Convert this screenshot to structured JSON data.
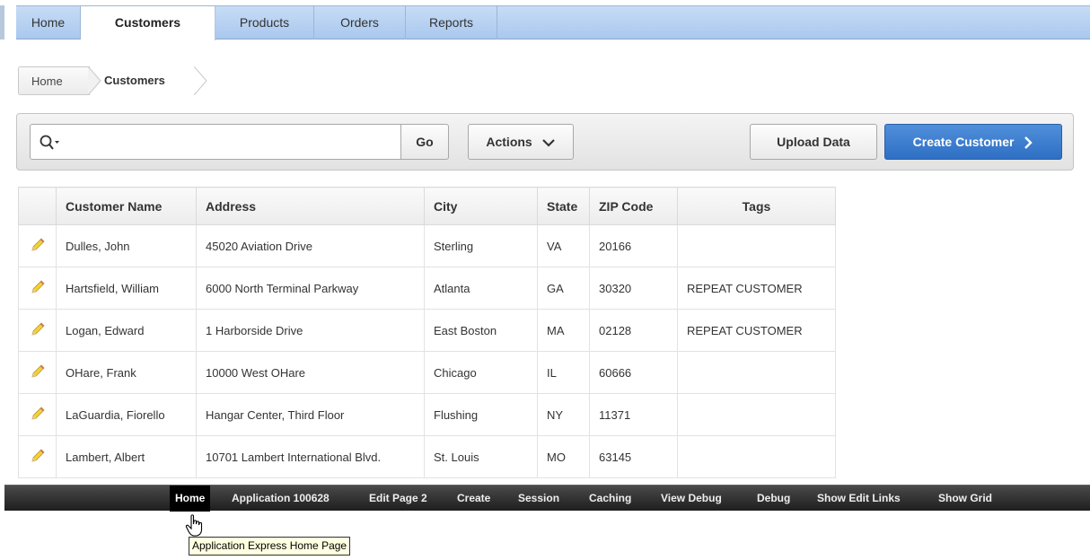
{
  "tabs": [
    {
      "label": "Home",
      "active": false
    },
    {
      "label": "Customers",
      "active": true
    },
    {
      "label": "Products",
      "active": false
    },
    {
      "label": "Orders",
      "active": false
    },
    {
      "label": "Reports",
      "active": false
    }
  ],
  "breadcrumb": {
    "home": "Home",
    "current": "Customers"
  },
  "toolbar": {
    "search_value": "",
    "go_label": "Go",
    "actions_label": "Actions",
    "upload_label": "Upload Data",
    "create_label": "Create Customer"
  },
  "table": {
    "headers": [
      "Customer Name",
      "Address",
      "City",
      "State",
      "ZIP Code",
      "Tags"
    ],
    "rows": [
      [
        "Dulles, John",
        "45020 Aviation Drive",
        "Sterling",
        "VA",
        "20166",
        ""
      ],
      [
        "Hartsfield, William",
        "6000 North Terminal Parkway",
        "Atlanta",
        "GA",
        "30320",
        "REPEAT CUSTOMER"
      ],
      [
        "Logan, Edward",
        "1 Harborside Drive",
        "East Boston",
        "MA",
        "02128",
        "REPEAT CUSTOMER"
      ],
      [
        "OHare, Frank",
        "10000 West OHare",
        "Chicago",
        "IL",
        "60666",
        ""
      ],
      [
        "LaGuardia, Fiorello",
        "Hangar Center, Third Floor",
        "Flushing",
        "NY",
        "11371",
        ""
      ],
      [
        "Lambert, Albert",
        "10701 Lambert International Blvd.",
        "St. Louis",
        "MO",
        "63145",
        ""
      ]
    ]
  },
  "devbar": {
    "links": [
      "Home",
      "Application 100628",
      "Edit Page 2",
      "Create",
      "Session",
      "Caching",
      "View Debug",
      "Debug",
      "Show Edit Links",
      "Show Grid"
    ]
  },
  "tooltip": "Application Express Home Page",
  "colors": {
    "accent": "#2f6fc4",
    "tabbar": "#b7d1f2",
    "devbar": "#2a2a2a"
  }
}
